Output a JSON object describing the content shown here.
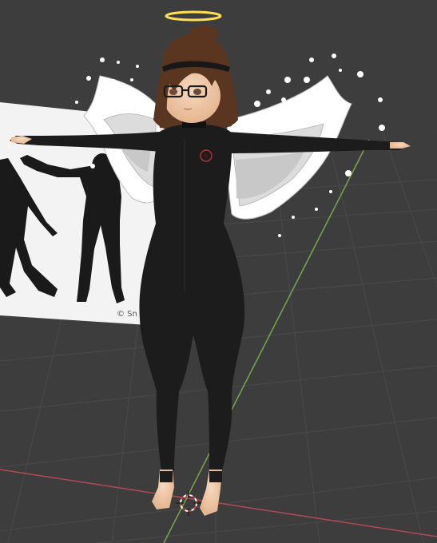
{
  "viewport": {
    "background": "#3d3d3d",
    "grid_color": "#4a4a4a",
    "x_axis_color": "#b04a55",
    "y_axis_color": "#7aa64a"
  },
  "reference_image": {
    "watermark": "© Sn"
  },
  "model": {
    "suit_color": "#1c1c1c",
    "hair_color": "#5a3520",
    "skin_color": "#f0c8a8",
    "halo_color": "#ffe050",
    "wings_color": "#ffffff",
    "icon": "character-model"
  },
  "icons": {
    "cursor": "3d-cursor-icon"
  }
}
